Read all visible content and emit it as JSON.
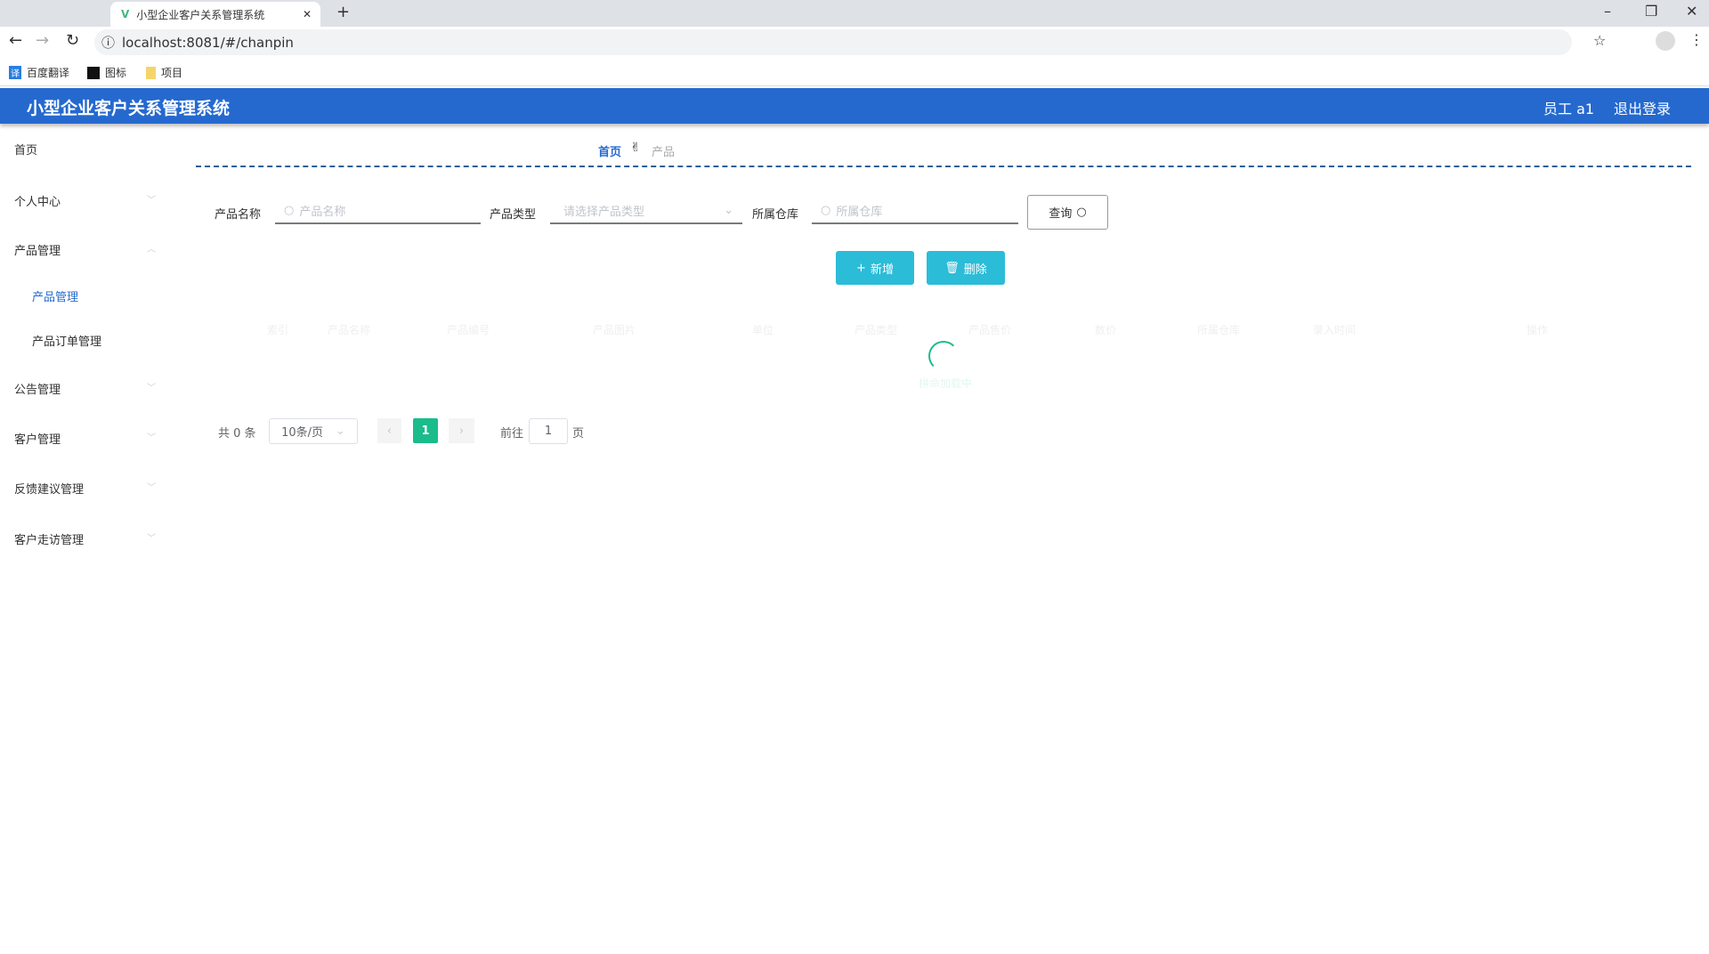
{
  "browser": {
    "tab_title": "小型企业客户关系管理系统",
    "url": "localhost:8081/#/chanpin",
    "bookmarks": [
      "百度翻译",
      "图标",
      "项目"
    ]
  },
  "header": {
    "title": "小型企业客户关系管理系统",
    "user": "员工 a1",
    "logout": "退出登录"
  },
  "sidebar": {
    "items": [
      {
        "label": "首页"
      },
      {
        "label": "个人中心"
      },
      {
        "label": "产品管理",
        "children": [
          "产品管理",
          "产品订单管理"
        ]
      },
      {
        "label": "公告管理"
      },
      {
        "label": "客户管理"
      },
      {
        "label": "反馈建议管理"
      },
      {
        "label": "客户走访管理"
      }
    ]
  },
  "breadcrumb": [
    "首页",
    "产品"
  ],
  "search": {
    "name_label": "产品名称",
    "name_placeholder": "产品名称",
    "type_label": "产品类型",
    "type_placeholder": "请选择产品类型",
    "warehouse_label": "所属仓库",
    "warehouse_placeholder": "所属仓库",
    "query_label": "查询"
  },
  "actions": {
    "add": "新增",
    "delete": "删除"
  },
  "table": {
    "columns": [
      "索引",
      "产品名称",
      "产品编号",
      "产品图片",
      "单位",
      "产品类型",
      "产品售价",
      "数价",
      "所属仓库",
      "录入时间",
      "操作"
    ],
    "loading_text": "拼命加载中"
  },
  "pagination": {
    "total": "共 0 条",
    "page_size": "10条/页",
    "current": "1",
    "goto_label": "前往",
    "goto_value": "1",
    "page_suffix": "页"
  },
  "colors": {
    "header": "#2569cf",
    "accent_button": "#2bbcd8",
    "active_page": "#1abc8c"
  }
}
